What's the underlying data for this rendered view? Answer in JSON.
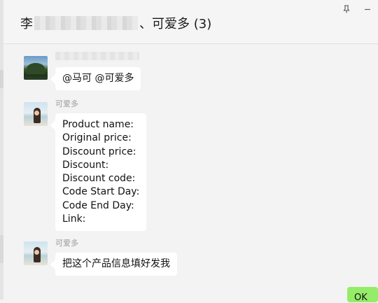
{
  "header": {
    "title_prefix": "李",
    "title_suffix": "、可爱多 (3)",
    "pin_icon": "pin-icon",
    "minimize_icon": "minimize-icon"
  },
  "messages": [
    {
      "sender": "",
      "avatar": "landscape-avatar",
      "lines": [
        "@马可 @可爱多"
      ]
    },
    {
      "sender": "可爱多",
      "avatar": "girl-avatar",
      "lines": [
        "Product name:",
        "Original price:",
        "Discount price:",
        "Discount:",
        "Discount code:",
        "Code Start Day:",
        "Code End Day:",
        "Link:"
      ]
    },
    {
      "sender": "可爱多",
      "avatar": "girl-avatar",
      "lines": [
        "把这个产品信息填好发我"
      ]
    }
  ],
  "own_message": {
    "text": "OK"
  },
  "colors": {
    "background": "#f3f3f3",
    "bubble": "#ffffff",
    "own_bubble": "#95ec69",
    "sender_text": "#9b9b9b"
  }
}
